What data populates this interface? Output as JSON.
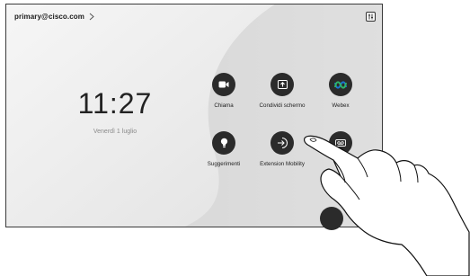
{
  "header": {
    "account": "primary@cisco.com"
  },
  "home": {
    "time": "11:27",
    "date": "Venerdì 1 luglio"
  },
  "tiles": [
    {
      "label": "Chiama",
      "icon": "video-camera-icon"
    },
    {
      "label": "Condividi schermo",
      "icon": "share-screen-icon"
    },
    {
      "label": "Webex",
      "icon": "webex-logo-icon"
    },
    {
      "label": "Suggerimenti",
      "icon": "lightbulb-icon"
    },
    {
      "label": "Extension Mobility",
      "icon": "sign-in-icon"
    },
    {
      "label": "",
      "icon": "voicemail-icon"
    }
  ],
  "colors": {
    "tile_dark": "#2b2b2b",
    "webex_blue": "#1a76d2",
    "webex_green": "#2fb26a"
  }
}
